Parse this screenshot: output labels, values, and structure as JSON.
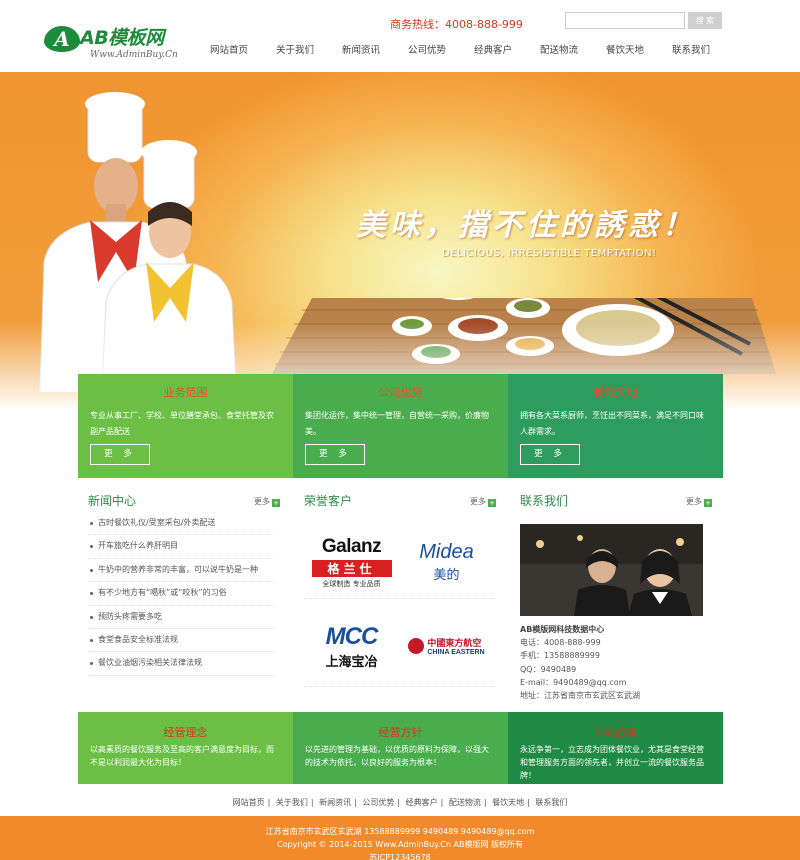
{
  "header": {
    "logo_text": "AB模板网",
    "logo_letter": "A",
    "logo_sub": "Www.AdminBuy.Cn",
    "hotline": "商务热线：4008-888-999",
    "search_placeholder": "",
    "search_button": "搜 索",
    "nav": [
      "网站首页",
      "关于我们",
      "新闻资讯",
      "公司优势",
      "经典客户",
      "配送物流",
      "餐饮天地",
      "联系我们"
    ]
  },
  "banner": {
    "slogan": "美味，擋不住的誘惑！",
    "slogan_en": "DELICIOUS, IRRESISTIBLE TEMPTATION!"
  },
  "features": [
    {
      "title": "业务范围",
      "text": "专业从事工厂、学校、单位膳堂承包、食堂托管及农副产品配送",
      "button": "更 多",
      "color": "#6bbf45"
    },
    {
      "title": "公司优势",
      "text": "集团化运作，集中统一管理，自营统一采购，价廉物美。",
      "button": "更 多",
      "color": "#49ad4d"
    },
    {
      "title": "餐饮天地",
      "text": "拥有各大菜系厨师，烹饪出不同菜系，满足不同口味人群需求。",
      "button": "更 多",
      "color": "#2e9c5c"
    }
  ],
  "news": {
    "title": "新闻中心",
    "more": "更多",
    "items": [
      "古时餐饮礼仪/受室采包/外卖配送",
      "开车旅吃什么养肝明目",
      "牛奶中的营养非常的丰富，可以说牛奶是一种",
      "有不少地方有“噶秋”或“咬秋”的习俗",
      "预防头疼需要多吃",
      "食堂食品安全标准法规",
      "餐饮业油烟污染相关法律法规"
    ]
  },
  "clients": {
    "title": "荣誉客户",
    "more": "更多",
    "logos": [
      {
        "name": "Galanz",
        "sub": "格兰仕",
        "tag": "全球制造  专业品质"
      },
      {
        "name": "Midea",
        "sub": "美的"
      },
      {
        "name": "MCC",
        "sub": "上海宝冶"
      },
      {
        "name": "中國東方航空",
        "sub": "CHINA EASTERN"
      }
    ]
  },
  "contact": {
    "title": "联系我们",
    "more": "更多",
    "lines": [
      "AB模版网科技数据中心",
      "电话：4008-888-999",
      "手机：13588889999",
      "QQ：9490489",
      "E-mail：9490489@qq.com",
      "地址：江苏省南京市玄武区玄武湖"
    ]
  },
  "bottom": [
    {
      "title": "经管理念",
      "text": "以高素质的餐饮服务及至高的客户满意度为目标，而不是以利润最大化为目标！",
      "color": "#6bbf45"
    },
    {
      "title": "经营方针",
      "text": "以先进的管理为基础，以优质的原料为保障，以强大的技术为依托，以良好的服务为根本！",
      "color": "#49ad4d"
    },
    {
      "title": "公司愿景",
      "text": "永远争第一，立志成为团体餐饮业，尤其是食堂经营和管理服务方面的领先者，并创立一流的餐饮服务品牌！",
      "color": "#2e9c5c"
    }
  ],
  "footer_nav": [
    "网站首页",
    "关于我们",
    "新闻资讯",
    "公司优势",
    "经典客户",
    "配送物流",
    "餐饮天地",
    "联系我们"
  ],
  "footer": {
    "line1": "江苏省南京市玄武区玄武湖   13588889999   9490489   9490489@qq.com",
    "line2": "Copyright © 2014-2015 Www.AdminBuy.Cn AB模版网 版权所有",
    "line3": "苏ICP12345678"
  }
}
